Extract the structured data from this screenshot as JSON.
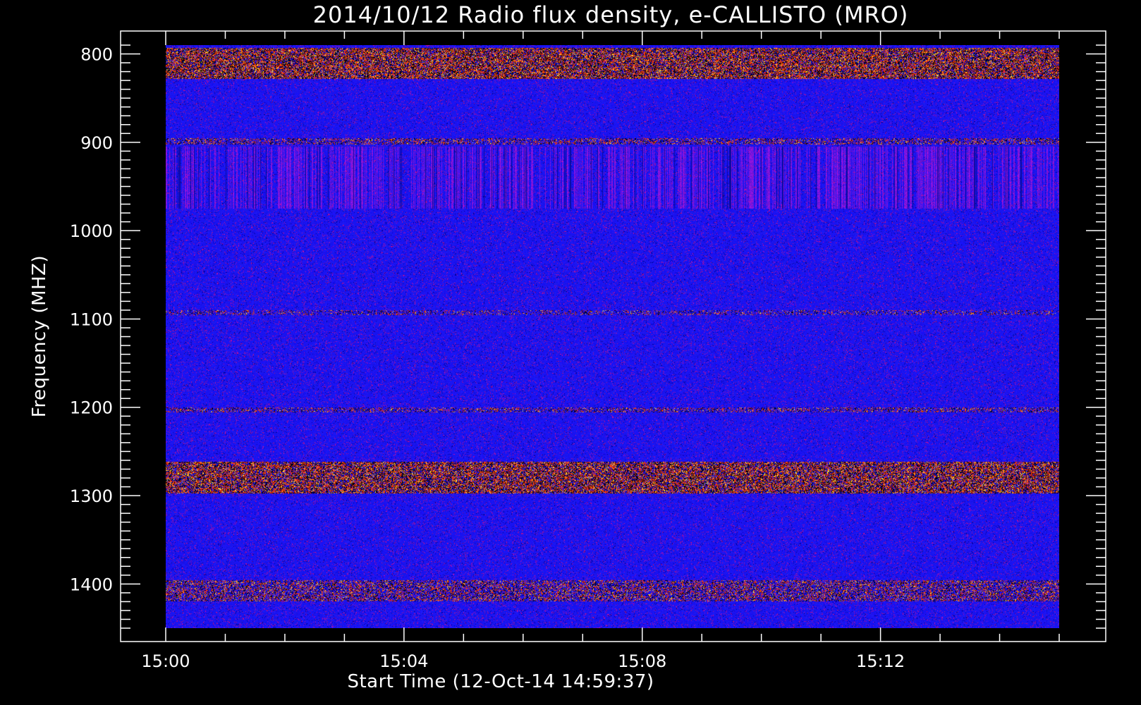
{
  "chart_data": {
    "type": "heatmap",
    "title": "2014/10/12  Radio flux density, e-CALLISTO (MRO)",
    "xlabel": "Start Time (12-Oct-14 14:59:37)",
    "ylabel": "Frequency (MHZ)",
    "x_range": [
      "15:00",
      "15:15"
    ],
    "x_ticks": [
      "15:00",
      "15:04",
      "15:08",
      "15:12"
    ],
    "y_range_mhz": [
      1450,
      790
    ],
    "y_ticks": [
      800,
      900,
      1000,
      1100,
      1200,
      1300,
      1400
    ],
    "y_inverted": true,
    "colormap": [
      "#000000",
      "#1a1aff",
      "#ff2a00",
      "#ffee55"
    ],
    "background_color": "#1717ff",
    "features": [
      {
        "kind": "intense-band",
        "freq_mhz": [
          793,
          828
        ],
        "intensity": 0.9
      },
      {
        "kind": "weak-band",
        "freq_mhz": [
          895,
          902
        ],
        "intensity": 0.45
      },
      {
        "kind": "vertical-striation",
        "freq_mhz": [
          905,
          975
        ],
        "intensity": 0.35
      },
      {
        "kind": "faint-line",
        "freq_mhz": [
          1090,
          1096
        ],
        "intensity": 0.3
      },
      {
        "kind": "faint-line",
        "freq_mhz": [
          1200,
          1206
        ],
        "intensity": 0.4
      },
      {
        "kind": "intense-band",
        "freq_mhz": [
          1262,
          1298
        ],
        "intensity": 0.85
      },
      {
        "kind": "weak-band",
        "freq_mhz": [
          1396,
          1420
        ],
        "intensity": 0.55
      }
    ]
  }
}
